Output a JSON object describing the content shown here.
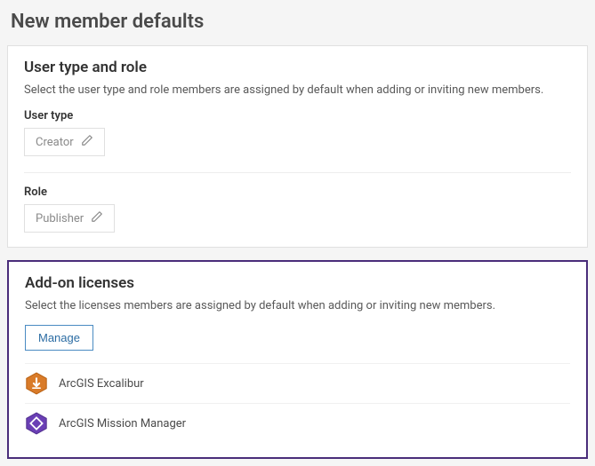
{
  "pageTitle": "New member defaults",
  "userTypeSection": {
    "title": "User type and role",
    "description": "Select the user type and role members are assigned by default when adding or inviting new members.",
    "userTypeLabel": "User type",
    "userTypeValue": "Creator",
    "roleLabel": "Role",
    "roleValue": "Publisher"
  },
  "addonSection": {
    "title": "Add-on licenses",
    "description": "Select the licenses members are assigned by default when adding or inviting new members.",
    "manageLabel": "Manage",
    "licenses": [
      {
        "name": "ArcGIS Excalibur",
        "iconKey": "excalibur"
      },
      {
        "name": "ArcGIS Mission Manager",
        "iconKey": "mission"
      }
    ]
  }
}
